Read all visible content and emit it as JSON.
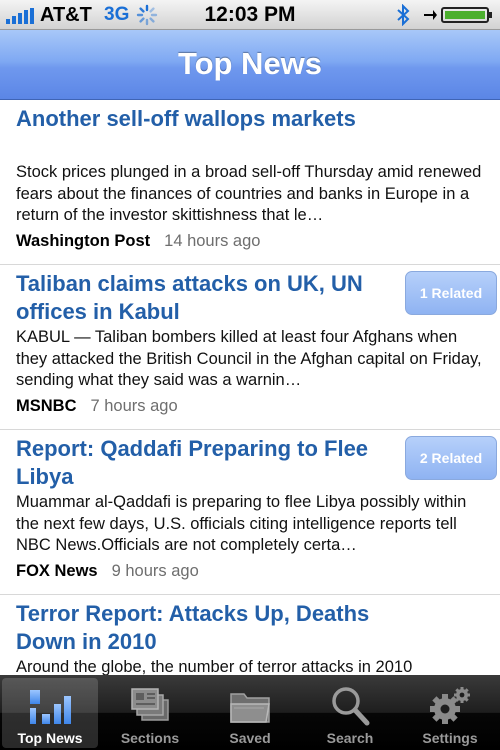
{
  "status_bar": {
    "carrier": "AT&T",
    "network": "3G",
    "time": "12:03 PM"
  },
  "nav": {
    "title": "Top News"
  },
  "news": [
    {
      "headline": "Another sell-off wallops markets",
      "summary": "Stock prices plunged in a broad sell-off Thursday amid renewed fears about the finances of countries and banks in Europe in a return of the investor skittishness that le…",
      "source": "Washington Post",
      "age": "14 hours ago",
      "related": ""
    },
    {
      "headline": "Taliban claims attacks on UK, UN offices in Kabul",
      "summary": "KABUL — Taliban bombers killed at least four Afghans when they attacked the British Council in the Afghan capital on Friday, sending what they said was a warnin…",
      "source": "MSNBC",
      "age": "7 hours ago",
      "related": "1 Related"
    },
    {
      "headline": "Report: Qaddafi Preparing to Flee Libya",
      "summary": "Muammar al-Qaddafi is preparing to flee Libya possibly within the next few days, U.S. officials citing intelligence reports tell NBC News.Officials are not completely certa…",
      "source": "FOX News",
      "age": "9 hours ago",
      "related": "2 Related"
    },
    {
      "headline": "Terror Report: Attacks Up, Deaths Down in 2010",
      "summary": "Around the globe, the number of terror attacks in 2010",
      "source": "",
      "age": "",
      "related": ""
    }
  ],
  "tabs": [
    {
      "label": "Top News",
      "icon": "top-news-bars-icon",
      "selected": true
    },
    {
      "label": "Sections",
      "icon": "sections-stack-icon",
      "selected": false
    },
    {
      "label": "Saved",
      "icon": "saved-folder-icon",
      "selected": false
    },
    {
      "label": "Search",
      "icon": "search-icon",
      "selected": false
    },
    {
      "label": "Settings",
      "icon": "gear-icon",
      "selected": false
    }
  ],
  "colors": {
    "headline": "#235fa8",
    "nav_bar": "#6f98ee",
    "related_button": "#9dbdf5",
    "tab_bar": "#1e1e1e"
  }
}
